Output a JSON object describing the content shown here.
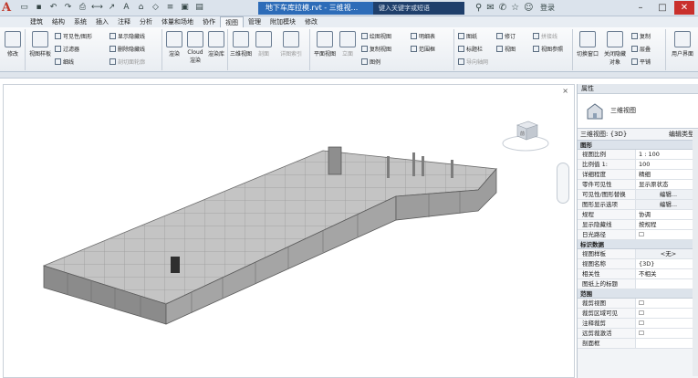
{
  "titlebar": {
    "logo": "A",
    "document_title": "地下车库拉模.rvt - 三维视...",
    "search_placeholder": "键入关键字或短语",
    "user": "登录"
  },
  "tabs": [
    "建筑",
    "结构",
    "系统",
    "插入",
    "注释",
    "分析",
    "体量和场地",
    "协作",
    "视图",
    "管理",
    "附加模块",
    "修改"
  ],
  "active_tab": "视图",
  "ribbon": {
    "modify": "修改",
    "view_templates": "视图样板",
    "visibility": "可见性/图形",
    "filters": "过滤器",
    "thin_lines": "细线",
    "show_hidden": "显示隐藏线",
    "remove_hidden": "删除隐藏线",
    "cut_profile": "剖切面轮廓",
    "render": "渲染",
    "cloud_render": "Cloud 渲染",
    "render_gallery": "渲染库",
    "3d_view": "三维视图",
    "section": "剖面",
    "callout": "详图索引",
    "plan_views": "平面视图",
    "elevation": "立面",
    "drafting_view": "绘图视图",
    "duplicate_view": "复制视图",
    "legends": "图例",
    "schedules": "明细表",
    "scope_box": "范围框",
    "sheet": "图纸",
    "title_block": "标题栏",
    "guide_grid": "导向轴网",
    "revisions": "修订",
    "view": "视图",
    "matchline": "拼接线",
    "view_reference": "视图参照",
    "switch_windows": "切换窗口",
    "close_hidden": "关闭隐藏对象",
    "replicate": "复制",
    "cascade": "层叠",
    "tile": "平铺",
    "user_interface": "用户界面"
  },
  "properties": {
    "panel_title": "属性",
    "type_name": "三维视图",
    "view_selector": "三维视图: {3D}",
    "edit_type": "编辑类型",
    "sections": [
      {
        "title": "图形",
        "rows": [
          {
            "k": "视图比例",
            "v": "1 : 100"
          },
          {
            "k": "比例值 1:",
            "v": "100"
          },
          {
            "k": "详细程度",
            "v": "精细"
          },
          {
            "k": "零件可见性",
            "v": "显示原状态"
          },
          {
            "k": "可见性/图形替换",
            "v": "编辑..."
          },
          {
            "k": "图形显示选项",
            "v": "编辑..."
          },
          {
            "k": "规程",
            "v": "协调"
          },
          {
            "k": "显示隐藏线",
            "v": "按规程"
          },
          {
            "k": "日光路径",
            "v": "☐"
          }
        ]
      },
      {
        "title": "标识数据",
        "rows": [
          {
            "k": "视图样板",
            "v": "<无>"
          },
          {
            "k": "视图名称",
            "v": "{3D}"
          },
          {
            "k": "相关性",
            "v": "不相关"
          },
          {
            "k": "图纸上的标题",
            "v": ""
          }
        ]
      },
      {
        "title": "范围",
        "rows": [
          {
            "k": "裁剪视图",
            "v": "☐"
          },
          {
            "k": "裁剪区域可见",
            "v": "☐"
          },
          {
            "k": "注释裁剪",
            "v": "☐"
          },
          {
            "k": "远剪裁激活",
            "v": "☐"
          },
          {
            "k": "剖面框",
            "v": ""
          }
        ]
      }
    ]
  },
  "viewport": {
    "viewcube_label": "前",
    "close": "×"
  }
}
